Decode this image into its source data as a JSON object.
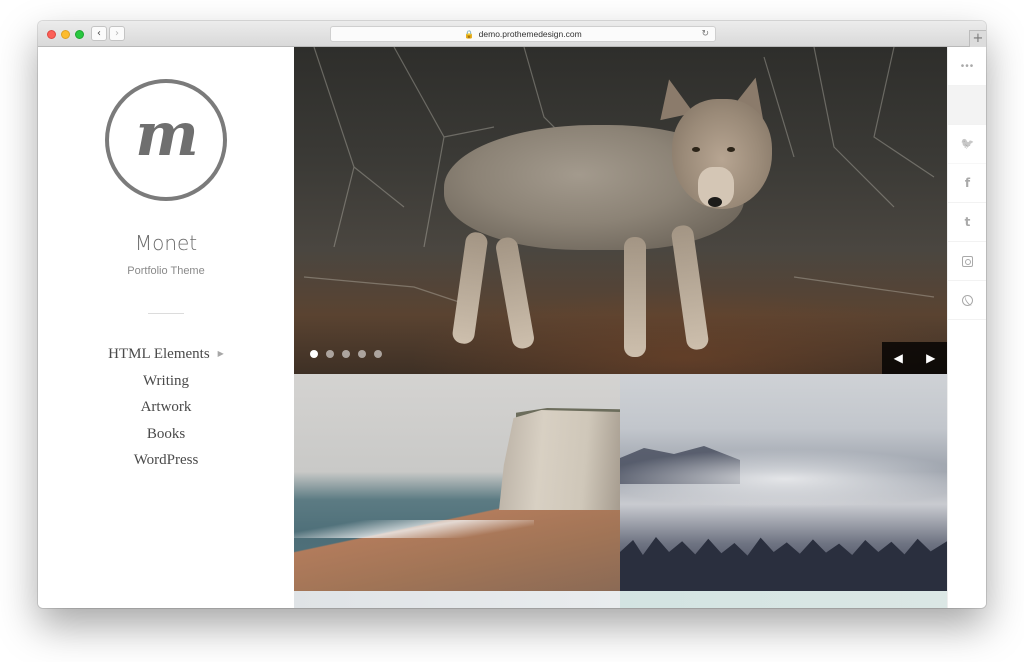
{
  "browser": {
    "url": "demo.prothemedesign.com",
    "back_glyph": "‹",
    "forward_glyph": "›",
    "lock_glyph": "🔒",
    "reload_glyph": "↻",
    "new_tab_glyph": "+"
  },
  "site": {
    "logo_letter": "m",
    "title": "Monet",
    "tagline": "Portfolio Theme"
  },
  "menu": {
    "items": [
      {
        "label": "HTML Elements",
        "has_submenu": true
      },
      {
        "label": "Writing"
      },
      {
        "label": "Artwork"
      },
      {
        "label": "Books"
      },
      {
        "label": "WordPress"
      }
    ],
    "submenu_caret": "▶"
  },
  "slider": {
    "slide_count": 5,
    "active_index": 0,
    "prev_glyph": "◀",
    "next_glyph": "▶"
  },
  "social": {
    "more_glyph": "•••",
    "twitter_glyph": "🐦",
    "facebook_glyph": "f",
    "tumblr_glyph": "t"
  },
  "colors": {
    "chrome_close": "#fc5f57",
    "chrome_minimize": "#fdbc2e",
    "chrome_zoom": "#29c840",
    "text_primary": "#4a4a4a",
    "icon_grey": "#a9a9a9"
  }
}
